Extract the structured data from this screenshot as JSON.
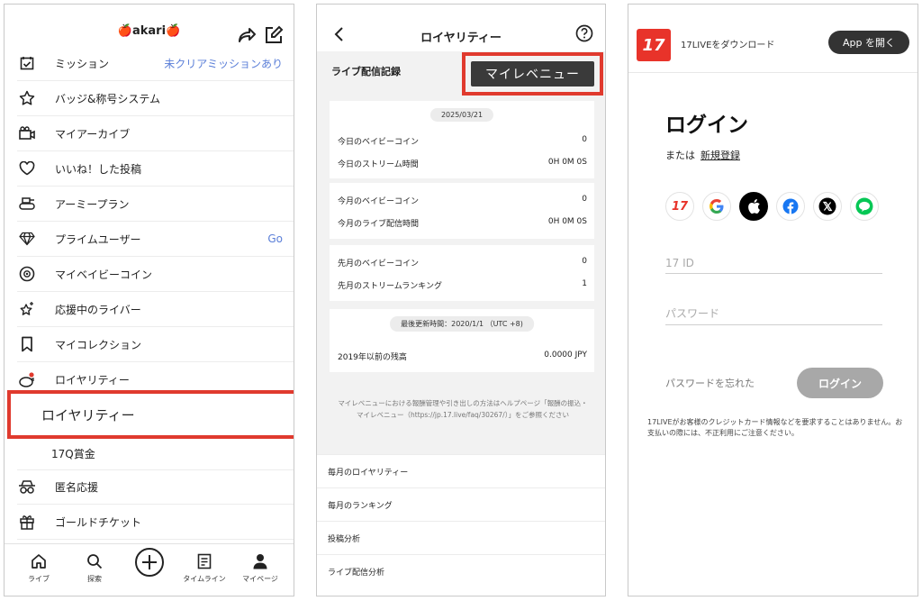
{
  "screen1": {
    "title": "🍎akari🍎",
    "menu": [
      {
        "icon": "calendar-check-icon",
        "label": "ミッション",
        "right": "未クリアミッションあり"
      },
      {
        "icon": "star-icon",
        "label": "バッジ&称号システム",
        "right": ""
      },
      {
        "icon": "archive-icon",
        "label": "マイアーカイブ",
        "right": ""
      },
      {
        "icon": "heart-icon",
        "label": "いいね！した投稿",
        "right": ""
      },
      {
        "icon": "tank-icon",
        "label": "アーミープラン",
        "right": ""
      },
      {
        "icon": "diamond-icon",
        "label": "プライムユーザー",
        "right": "Go"
      },
      {
        "icon": "coin-icon",
        "label": "マイベイビーコイン",
        "right": ""
      },
      {
        "icon": "sparkle-star-icon",
        "label": "応援中のライバー",
        "right": ""
      },
      {
        "icon": "bookmark-icon",
        "label": "マイコレクション",
        "right": ""
      },
      {
        "icon": "piggy-bank-icon",
        "label": "ロイヤリティー",
        "right": ""
      }
    ],
    "highlight_label": "ロイヤリティー",
    "sub_item": "17Q賞金",
    "menu_after": [
      {
        "icon": "anonymous-icon",
        "label": "匿名応援",
        "right": ""
      },
      {
        "icon": "gift-icon",
        "label": "ゴールドチケット",
        "right": ""
      }
    ],
    "tabs": [
      {
        "icon": "home-icon",
        "label": "ライブ"
      },
      {
        "icon": "search-icon",
        "label": "探索"
      },
      {
        "icon": "timeline-icon",
        "label": "タイムライン"
      },
      {
        "icon": "person-icon",
        "label": "マイページ"
      }
    ]
  },
  "screen2": {
    "title": "ロイヤリティー",
    "section": "ライブ配信記録",
    "revenue_button": "マイレベニュー",
    "card1": {
      "date": "2025/03/21",
      "rows": [
        {
          "label": "今日のベイビーコイン",
          "value": "0"
        },
        {
          "label": "今日のストリーム時間",
          "value": "0H 0M 0S"
        }
      ]
    },
    "card2": {
      "rows": [
        {
          "label": "今月のベイビーコイン",
          "value": "0"
        },
        {
          "label": "今月のライブ配信時間",
          "value": "0H 0M 0S"
        }
      ]
    },
    "card3": {
      "rows": [
        {
          "label": "先月のベイビーコイン",
          "value": "0"
        },
        {
          "label": "先月のストリームランキング",
          "value": "1"
        }
      ]
    },
    "card4": {
      "updated": "最後更新時間：2020/1/1 （UTC +8)",
      "rows": [
        {
          "label": "2019年以前の残高",
          "value": "0.0000 JPY"
        }
      ]
    },
    "note": "マイレベニューにおける報酬管理や引き出しの方法はヘルプページ「報酬の振込・マイレベニュー（https://jp.17.live/faq/30267/）」をご参照ください",
    "list": [
      "毎月のロイヤリティー",
      "毎月のランキング",
      "投稿分析",
      "ライブ配信分析"
    ]
  },
  "screen3": {
    "logo": "17",
    "download_text": "17LIVEをダウンロード",
    "open_app": "App を開く",
    "heading": "ログイン",
    "or_text": "または",
    "register": "新規登録",
    "id_placeholder": "17 ID",
    "password_placeholder": "パスワード",
    "forgot": "パスワードを忘れた",
    "login_button": "ログイン",
    "note": "17LIVEがお客様のクレジットカード情報などを要求することはありません。お支払いの際には、不正利用にご注意ください。"
  },
  "colors": {
    "highlight": "#e03a2e",
    "link_blue": "#5b7fd8",
    "brand_red": "#e8332a"
  }
}
